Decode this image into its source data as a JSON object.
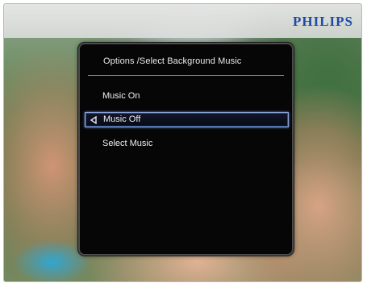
{
  "brand": "PHILIPS",
  "menu": {
    "title": "Options /Select Background Music",
    "items": [
      {
        "label": "Music On",
        "selected": false
      },
      {
        "label": "Music Off",
        "selected": true
      },
      {
        "label": "Select Music",
        "selected": false
      }
    ],
    "selected_icon": "left-arrow-icon"
  },
  "colors": {
    "panel_background": "#060606",
    "selection_border": "#8aa4d8",
    "brand_color": "#1f4aa8"
  }
}
